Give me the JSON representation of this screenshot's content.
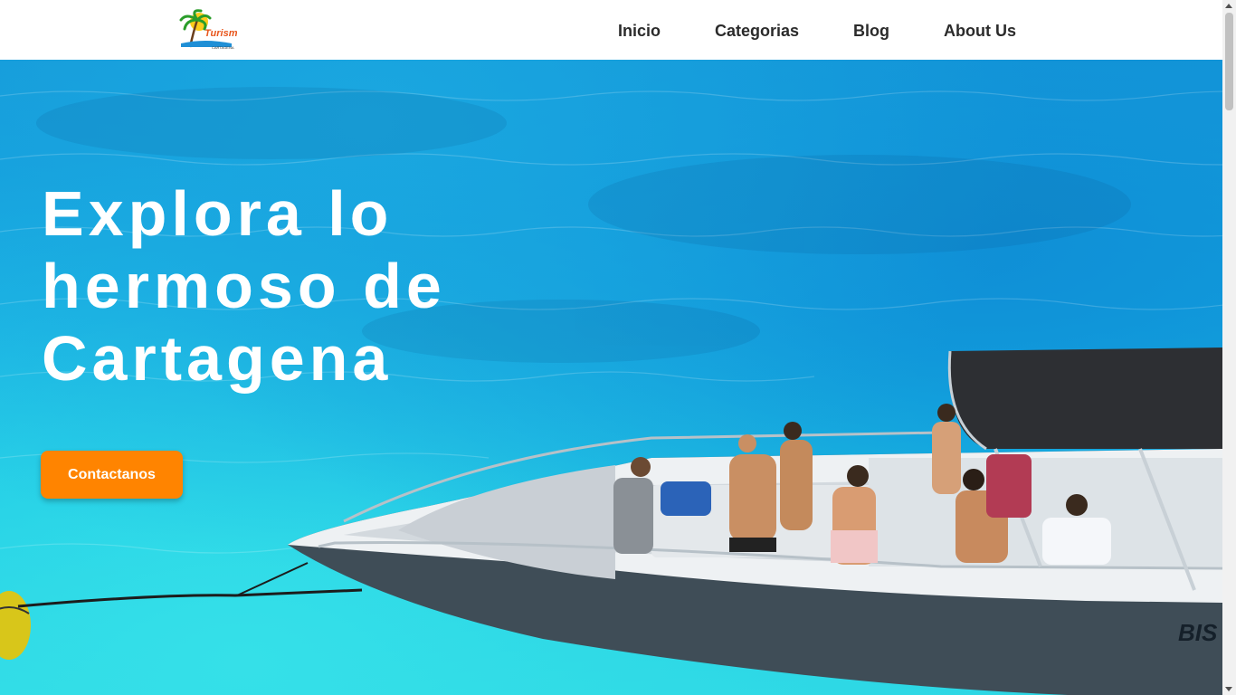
{
  "header": {
    "logo_alt": "Turismo Cartagena",
    "nav": [
      {
        "label": "Inicio"
      },
      {
        "label": "Categorias"
      },
      {
        "label": "Blog"
      },
      {
        "label": "About Us"
      }
    ]
  },
  "hero": {
    "headline_lines": [
      "Explora lo",
      "hermoso de",
      "Cartagena"
    ],
    "cta_label": "Contactanos",
    "boat_hull_text": "BIS"
  },
  "colors": {
    "accent": "#ff8400",
    "sea": "#14a9e2",
    "nav_text": "#2b2b2b"
  }
}
